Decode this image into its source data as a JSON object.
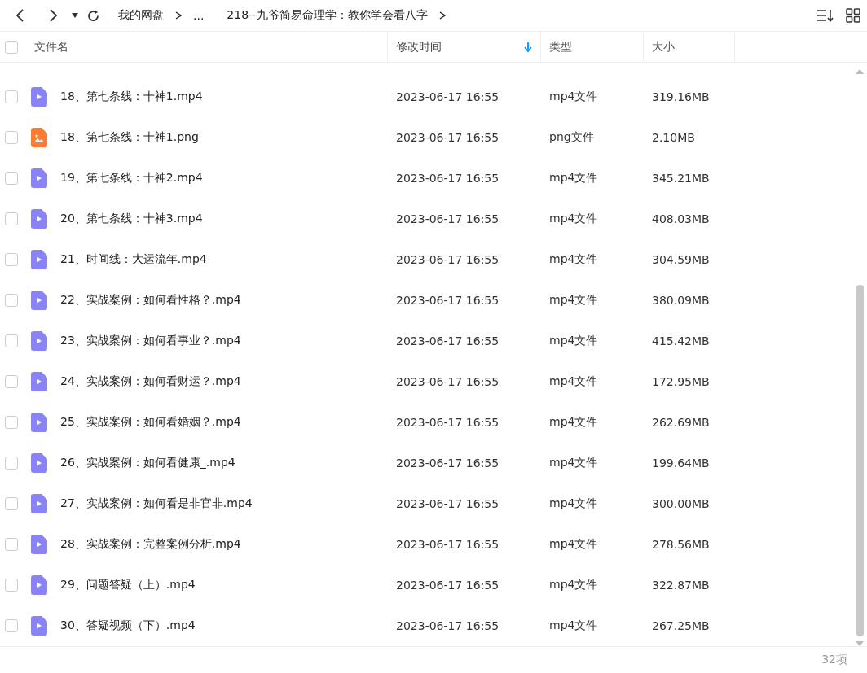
{
  "breadcrumb": [
    {
      "kind": "folder",
      "label": "我的网盘"
    },
    {
      "kind": "ellipsis",
      "label": "..."
    },
    {
      "kind": "folder",
      "label": "218--九爷简易命理学：教你学会看八字"
    }
  ],
  "columns": [
    {
      "label": "文件名",
      "sorted": false
    },
    {
      "label": "修改时间",
      "sorted": true
    },
    {
      "label": "类型",
      "sorted": false
    },
    {
      "label": "大小",
      "sorted": false
    }
  ],
  "rows": [
    {
      "kind": "video",
      "name": "18、第七条线：十神1.mp4",
      "time": "2023-06-17 16:55",
      "type": "mp4文件",
      "size": "319.16MB",
      "checked": false
    },
    {
      "kind": "image",
      "name": "18、第七条线：十神1.png",
      "time": "2023-06-17 16:55",
      "type": "png文件",
      "size": "2.10MB",
      "checked": false
    },
    {
      "kind": "video",
      "name": "19、第七条线：十神2.mp4",
      "time": "2023-06-17 16:55",
      "type": "mp4文件",
      "size": "345.21MB",
      "checked": false
    },
    {
      "kind": "video",
      "name": "20、第七条线：十神3.mp4",
      "time": "2023-06-17 16:55",
      "type": "mp4文件",
      "size": "408.03MB",
      "checked": false
    },
    {
      "kind": "video",
      "name": "21、时间线：大运流年.mp4",
      "time": "2023-06-17 16:55",
      "type": "mp4文件",
      "size": "304.59MB",
      "checked": false
    },
    {
      "kind": "video",
      "name": "22、实战案例：如何看性格？.mp4",
      "time": "2023-06-17 16:55",
      "type": "mp4文件",
      "size": "380.09MB",
      "checked": false
    },
    {
      "kind": "video",
      "name": "23、实战案例：如何看事业？.mp4",
      "time": "2023-06-17 16:55",
      "type": "mp4文件",
      "size": "415.42MB",
      "checked": false
    },
    {
      "kind": "video",
      "name": "24、实战案例：如何看财运？.mp4",
      "time": "2023-06-17 16:55",
      "type": "mp4文件",
      "size": "172.95MB",
      "checked": false
    },
    {
      "kind": "video",
      "name": "25、实战案例：如何看婚姻？.mp4",
      "time": "2023-06-17 16:55",
      "type": "mp4文件",
      "size": "262.69MB",
      "checked": false
    },
    {
      "kind": "video",
      "name": "26、实战案例：如何看健康_.mp4",
      "time": "2023-06-17 16:55",
      "type": "mp4文件",
      "size": "199.64MB",
      "checked": false
    },
    {
      "kind": "video",
      "name": "27、实战案例：如何看是非官非.mp4",
      "time": "2023-06-17 16:55",
      "type": "mp4文件",
      "size": "300.00MB",
      "checked": false
    },
    {
      "kind": "video",
      "name": "28、实战案例：完整案例分析.mp4",
      "time": "2023-06-17 16:55",
      "type": "mp4文件",
      "size": "278.56MB",
      "checked": false
    },
    {
      "kind": "video",
      "name": "29、问题答疑（上）.mp4",
      "time": "2023-06-17 16:55",
      "type": "mp4文件",
      "size": "322.87MB",
      "checked": false
    },
    {
      "kind": "video",
      "name": "30、答疑视频（下）.mp4",
      "time": "2023-06-17 16:55",
      "type": "mp4文件",
      "size": "267.25MB",
      "checked": false
    }
  ],
  "select_all": {
    "checked": false
  },
  "status_bar": {
    "count": "32项"
  }
}
